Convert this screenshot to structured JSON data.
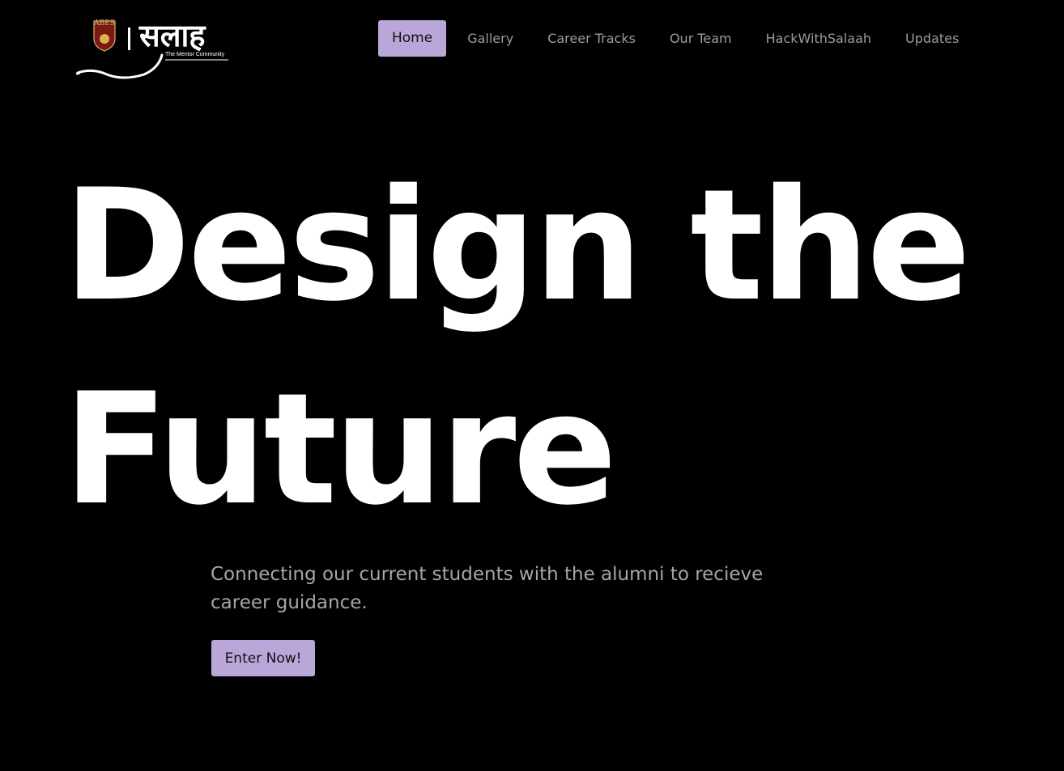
{
  "logo": {
    "crest_text": "ABES",
    "script_text": "सलाह",
    "tagline": "The Mentor Community"
  },
  "nav": {
    "items": [
      {
        "label": "Home",
        "active": true
      },
      {
        "label": "Gallery",
        "active": false
      },
      {
        "label": "Career Tracks",
        "active": false
      },
      {
        "label": "Our Team",
        "active": false
      },
      {
        "label": "HackWithSalaah",
        "active": false
      },
      {
        "label": "Updates",
        "active": false
      }
    ]
  },
  "hero": {
    "title_line1": "Design the",
    "title_line2": "Future",
    "subtitle": "Connecting our current students with the alumni to recieve career guidance.",
    "cta_label": "Enter Now!"
  },
  "colors": {
    "background": "#000000",
    "accent": "#baa7da",
    "nav_text": "#9c9c9c",
    "subtitle_text": "#a6a6a6"
  }
}
